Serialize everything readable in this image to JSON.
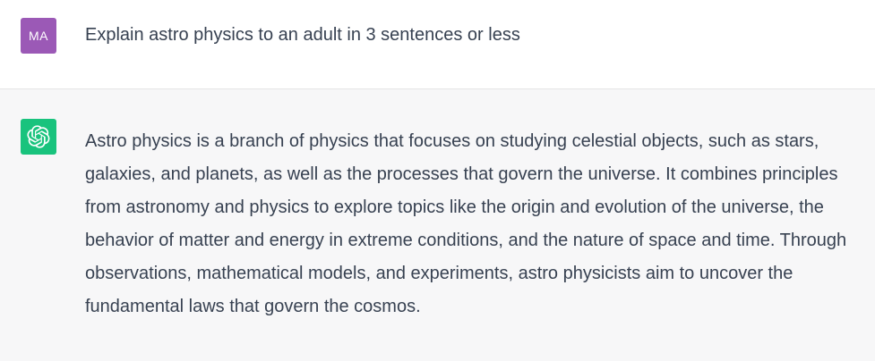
{
  "conversation": {
    "user": {
      "avatar_initials": "MA",
      "avatar_color": "#9b59b6",
      "message": "Explain astro physics to an adult in 3 sentences or less"
    },
    "assistant": {
      "avatar_icon": "openai-logo-icon",
      "avatar_color": "#19c37d",
      "message": "Astro physics is a branch of physics that focuses on studying celestial objects, such as stars, galaxies, and planets, as well as the processes that govern the universe. It combines principles from astronomy and physics to explore topics like the origin and evolution of the universe, the behavior of matter and energy in extreme conditions, and the nature of space and time. Through observations, mathematical models, and experiments, astro physicists aim to uncover the fundamental laws that govern the cosmos."
    }
  }
}
